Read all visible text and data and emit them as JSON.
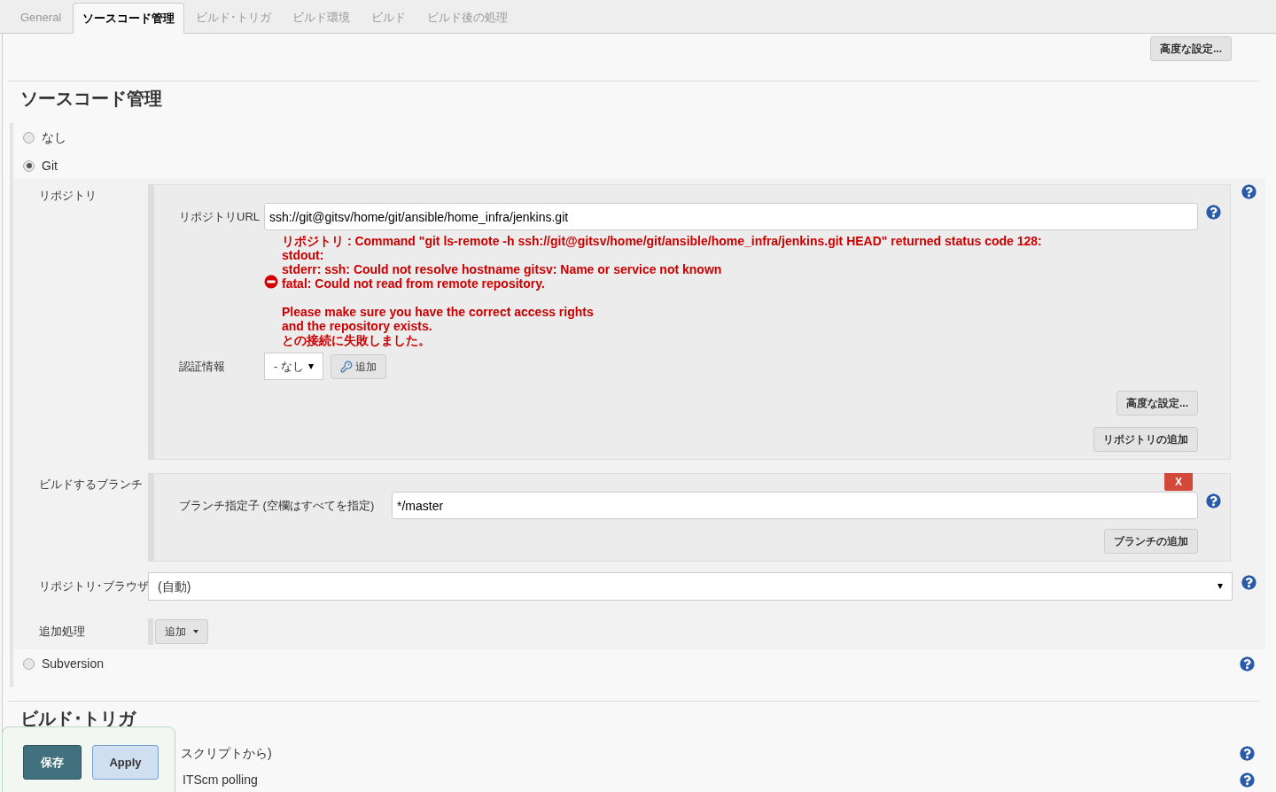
{
  "tabs": [
    {
      "label": "General",
      "selected": false
    },
    {
      "label": "ソースコード管理",
      "selected": true
    },
    {
      "label": "ビルド･トリガ",
      "selected": false
    },
    {
      "label": "ビルド環境",
      "selected": false
    },
    {
      "label": "ビルド",
      "selected": false
    },
    {
      "label": "ビルド後の処理",
      "selected": false
    }
  ],
  "top_button": "高度な設定...",
  "section_title": "ソースコード管理",
  "scm_options": [
    {
      "label": "なし",
      "selected": false
    },
    {
      "label": "Git",
      "selected": true
    },
    {
      "label": "Subversion",
      "selected": false
    }
  ],
  "git": {
    "repositories_label": "リポジトリ",
    "url_label": "リポジトリURL",
    "url_value": "ssh://git@gitsv/home/git/ansible/home_infra/jenkins.git",
    "error_paragraphs": [
      [
        "リポジトリ : Command \"git ls-remote -h ssh://git@gitsv/home/git/ansible/home_infra/jenkins.git HEAD\" returned status code 128:",
        "stdout:",
        "stderr: ssh: Could not resolve hostname gitsv: Name or service not known",
        "fatal: Could not read from remote repository."
      ],
      [
        "Please make sure you have the correct access rights",
        "and the repository exists.",
        "との接続に失敗しました。"
      ]
    ],
    "credentials_label": "認証情報",
    "credentials_value": "- なし",
    "credentials_add": "追加",
    "advanced_button": "高度な設定...",
    "add_repository_button": "リポジトリの追加",
    "branches_label": "ビルドするブランチ",
    "delete_button": "X",
    "branch_label": "ブランチ指定子 (空欄はすべてを指定)",
    "branch_value": "*/master",
    "add_branch_button": "ブランチの追加",
    "browser_label": "リポジトリ･ブラウザ",
    "browser_value": "(自動)",
    "additional_label": "追加処理",
    "additional_button": "追加"
  },
  "triggers_title": "ビルド･トリガ",
  "triggers": [
    {
      "label": "スクリプトから)"
    },
    {
      "label": "ITScm polling"
    }
  ],
  "save_bar": {
    "save": "保存",
    "apply": "Apply"
  }
}
